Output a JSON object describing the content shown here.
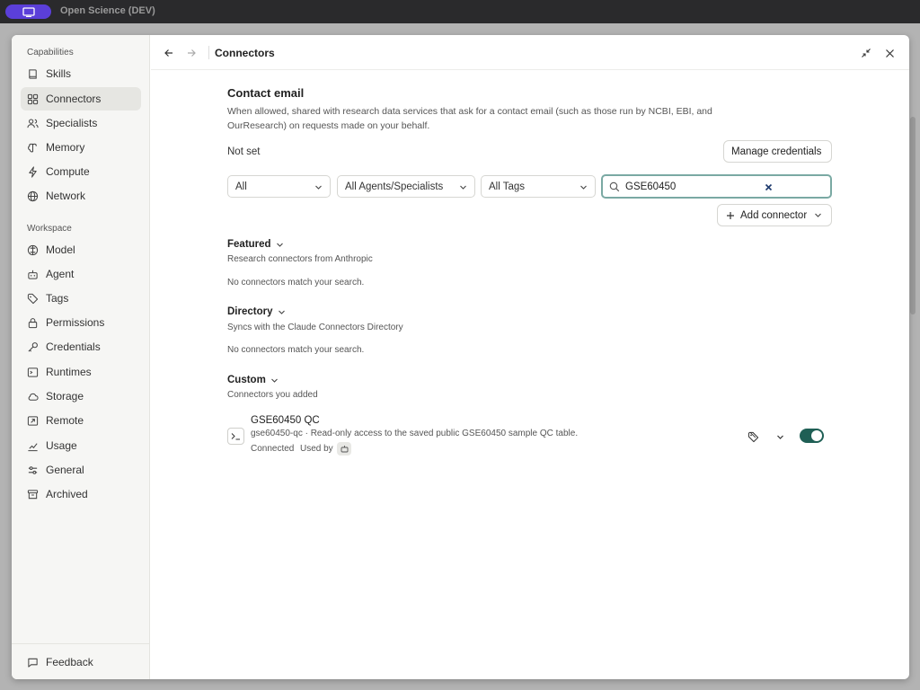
{
  "app": {
    "title": "Open Science (DEV)"
  },
  "sidebar": {
    "capabilities_label": "Capabilities",
    "capabilities": [
      {
        "label": "Skills",
        "icon": "book-icon"
      },
      {
        "label": "Connectors",
        "icon": "grid-icon",
        "active": true
      },
      {
        "label": "Specialists",
        "icon": "users-icon"
      },
      {
        "label": "Memory",
        "icon": "brain-icon"
      },
      {
        "label": "Compute",
        "icon": "bolt-icon"
      },
      {
        "label": "Network",
        "icon": "globe-icon"
      }
    ],
    "workspace_label": "Workspace",
    "workspace": [
      {
        "label": "Model",
        "icon": "model-icon"
      },
      {
        "label": "Agent",
        "icon": "robot-icon"
      },
      {
        "label": "Tags",
        "icon": "tag-icon"
      },
      {
        "label": "Permissions",
        "icon": "lock-icon"
      },
      {
        "label": "Credentials",
        "icon": "key-icon"
      },
      {
        "label": "Runtimes",
        "icon": "terminal-icon"
      },
      {
        "label": "Storage",
        "icon": "cloud-icon"
      },
      {
        "label": "Remote",
        "icon": "remote-icon"
      },
      {
        "label": "Usage",
        "icon": "chart-icon"
      },
      {
        "label": "General",
        "icon": "sliders-icon"
      },
      {
        "label": "Archived",
        "icon": "archive-icon"
      }
    ],
    "feedback_label": "Feedback"
  },
  "header": {
    "title": "Connectors"
  },
  "contact": {
    "title": "Contact email",
    "description": "When allowed, shared with research data services that ask for a contact email (such as those run by NCBI, EBI, and OurResearch) on requests made on your behalf.",
    "status": "Not set",
    "manage_label": "Manage credentials"
  },
  "filters": {
    "scope": "All",
    "agents": "All Agents/Specialists",
    "tags": "All Tags",
    "search_value": "GSE60450"
  },
  "add_connector_label": "Add connector",
  "sections": {
    "featured": {
      "title": "Featured",
      "subtitle": "Research connectors from Anthropic",
      "empty": "No connectors match your search."
    },
    "directory": {
      "title": "Directory",
      "subtitle": "Syncs with the Claude Connectors Directory",
      "empty": "No connectors match your search."
    },
    "custom": {
      "title": "Custom",
      "subtitle": "Connectors you added"
    }
  },
  "connector": {
    "name": "GSE60450 QC",
    "description": "gse60450-qc · Read-only access to the saved public GSE60450 sample QC table.",
    "status": "Connected",
    "used_by_label": "Used by",
    "enabled": true
  },
  "colors": {
    "accent": "#5b3fd9",
    "toggle_on": "#1f5f55",
    "search_focus": "#7aa9a3"
  }
}
